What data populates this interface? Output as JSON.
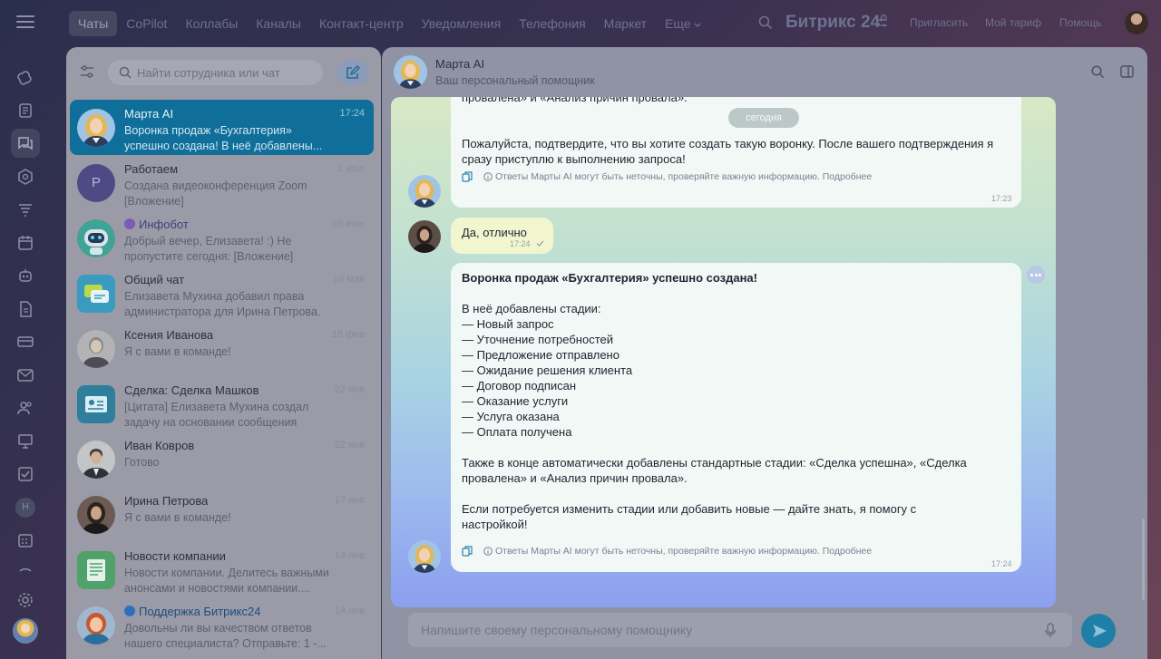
{
  "topbar": {
    "nav": [
      "Чаты",
      "CoPilot",
      "Коллабы",
      "Каналы",
      "Контакт-центр",
      "Уведомления",
      "Телефония",
      "Маркет",
      "Еще"
    ],
    "brand": "Битрикс 24",
    "brand_mark": "⊙",
    "invite": "Пригласить",
    "tariff": "Мой тариф",
    "help": "Помощь"
  },
  "rail": {
    "letter_badge": "Н",
    "icons": [
      "copilot-icon",
      "feed-icon",
      "chats-icon",
      "collabs-icon",
      "crm-filter-icon",
      "calendar-icon",
      "bot-icon",
      "document-icon",
      "card-icon",
      "mail-icon",
      "contacts-icon",
      "presentation-icon",
      "tasks-icon",
      "letter-badge",
      "schedule-icon",
      "settings-icon",
      "profile-avatar"
    ]
  },
  "list": {
    "search_placeholder": "Найти сотрудника или чат",
    "chats": [
      {
        "title": "Марта AI",
        "time": "17:24",
        "preview": "Воронка продаж «Бухгалтерия» успешно создана! В неё добавлены...",
        "avatar": "marta",
        "active": true
      },
      {
        "title": "Работаем",
        "time": "1 июл",
        "preview": "Создана видеоконференция Zoom [Вложение]",
        "avatar": "letter",
        "letter": "Р"
      },
      {
        "title": "Инфобот",
        "time": "26 июн",
        "preview": "Добрый вечер, Елизавета! :) Не пропустите сегодня: [Вложение]",
        "avatar": "bot",
        "badge": "bot"
      },
      {
        "title": "Общий чат",
        "time": "16 мая",
        "preview": "Елизавета Мухина добавил права администратора для Ирина Петрова.",
        "avatar": "general"
      },
      {
        "title": "Ксения Иванова",
        "time": "18 фев",
        "preview": "Я с вами в команде!",
        "avatar": "person-grey"
      },
      {
        "title": "Сделка: Сделка Машков",
        "time": "22 янв",
        "preview": "[Цитата] Елизавета Мухина создал задачу на основании сообщения",
        "avatar": "deal"
      },
      {
        "title": "Иван Ковров",
        "time": "22 янв",
        "preview": "Готово",
        "avatar": "person-man"
      },
      {
        "title": "Ирина Петрова",
        "time": "17 янв",
        "preview": "Я с вами в команде!",
        "avatar": "person-dark"
      },
      {
        "title": "Новости компании",
        "time": "14 янв",
        "preview": "Новости компании. Делитесь важными анонсами и новостями компании....",
        "avatar": "news"
      },
      {
        "title": "Поддержка Битрикс24",
        "time": "14 янв",
        "preview": "Довольны ли вы качеством ответов нашего специалиста? Отправьте: 1 -...",
        "avatar": "support",
        "badge": "support"
      }
    ]
  },
  "chat": {
    "title": "Марта AI",
    "subtitle": "Ваш персональный помощник",
    "composer_placeholder": "Напишите своему персональному помощнику"
  },
  "dialog": {
    "top_fragment": "провалена» и «Анализ причин провала».",
    "day_label": "сегодня",
    "confirm_text": "Пожалуйста, подтвердите, что вы хотите создать такую воронку. После вашего подтверждения я сразу приступлю к выполнению запроса!",
    "disclaimer": "Ответы Марты AI могут быть неточны, проверяйте важную информацию.",
    "more_link": "Подробнее",
    "confirm_time": "17:23",
    "user_text": "Да, отлично",
    "user_time": "17:24",
    "final_title": "Воронка продаж «Бухгалтерия» успешно создана!",
    "final_intro": "В неё добавлены стадии:",
    "stages": [
      "— Новый запрос",
      "— Уточнение потребностей",
      "— Предложение отправлено",
      "— Ожидание решения клиента",
      "— Договор подписан",
      "— Оказание услуги",
      "— Услуга оказана",
      "— Оплата получена"
    ],
    "final_extra": "Также в конце автоматически добавлены стандартные стадии: «Сделка успешна», «Сделка провалена» и «Анализ причин провала».",
    "final_outro": "Если потребуется изменить стадии или добавить новые — дайте знать, я помогу с настройкой!",
    "final_time": "17:24"
  },
  "colors": {
    "active_chat": "#0f6f9a",
    "send_button": "#1f7fa6",
    "bot_bubble": "#f2f8f6",
    "user_bubble": "#f1f6cf"
  }
}
